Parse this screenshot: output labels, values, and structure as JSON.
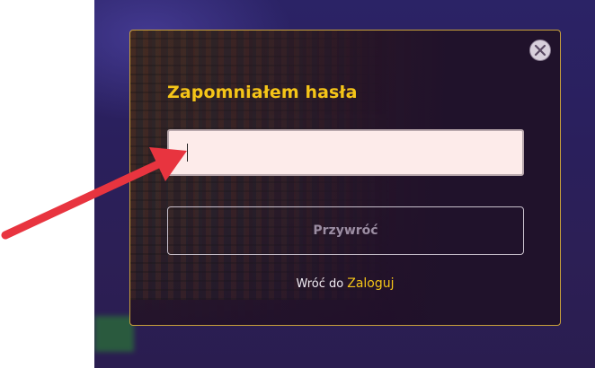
{
  "modal": {
    "title": "Zapomniałem hasła",
    "email_input": {
      "value": "",
      "placeholder": ""
    },
    "restore_button_label": "Przywróć",
    "back_text": "Wróć do",
    "login_link_label": "Zaloguj",
    "close_icon": "close-icon"
  },
  "annotation": {
    "type": "arrow",
    "color": "#e8343f"
  },
  "colors": {
    "accent": "#f5c518",
    "modal_border": "#c9a13a",
    "input_background": "#fdebea",
    "modal_background": "#20122b"
  }
}
